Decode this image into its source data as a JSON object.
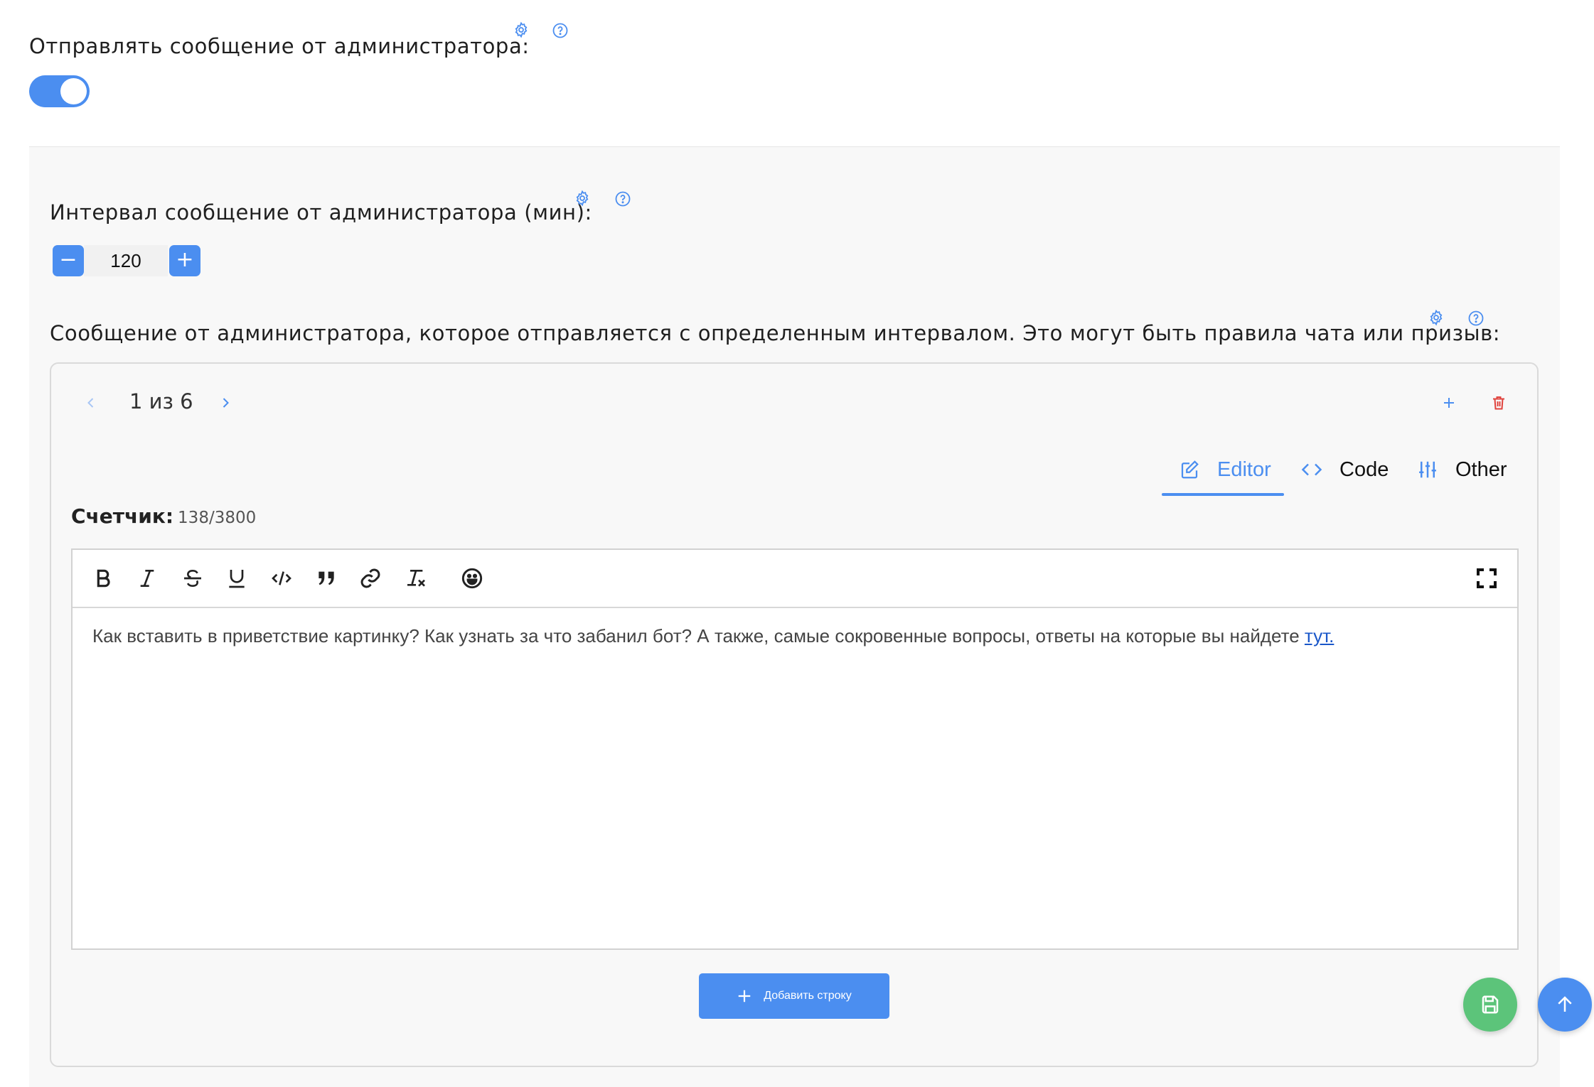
{
  "settings": {
    "send_admin_message": {
      "label": "Отправлять сообщение от администратора:",
      "enabled": true
    },
    "interval": {
      "label": "Интервал сообщение от администратора (мин):",
      "value": "120",
      "decrement": "−",
      "increment": "+"
    },
    "message": {
      "label": "Сообщение от администратора, которое отправляется с определенным интервалом. Это могут быть правила чата или призыв:"
    }
  },
  "card": {
    "pager": "1 из 6",
    "tabs": [
      {
        "label": "Editor",
        "icon": "edit-icon",
        "active": true
      },
      {
        "label": "Code",
        "icon": "code-icon",
        "active": false
      },
      {
        "label": "Other",
        "icon": "sliders-icon",
        "active": false
      }
    ],
    "counter_label": "Счетчик:",
    "counter_value": "138/3800",
    "editor": {
      "toolbar": [
        "bold-icon",
        "italic-icon",
        "strikethrough-icon",
        "underline-icon",
        "code-icon",
        "quote-icon",
        "link-icon",
        "clear-format-icon",
        "emoji-icon",
        "fullscreen-icon"
      ],
      "text": "Как вставить в приветствие картинку? Как узнать за что забанил бот?  А также, самые сокровенные вопросы, ответы на которые вы найдете ",
      "link_text": "тут."
    },
    "add_row_label": "Добавить строку"
  },
  "colors": {
    "accent": "#4b8ef0",
    "danger": "#e0423c",
    "save_fab": "#5cc47a"
  }
}
